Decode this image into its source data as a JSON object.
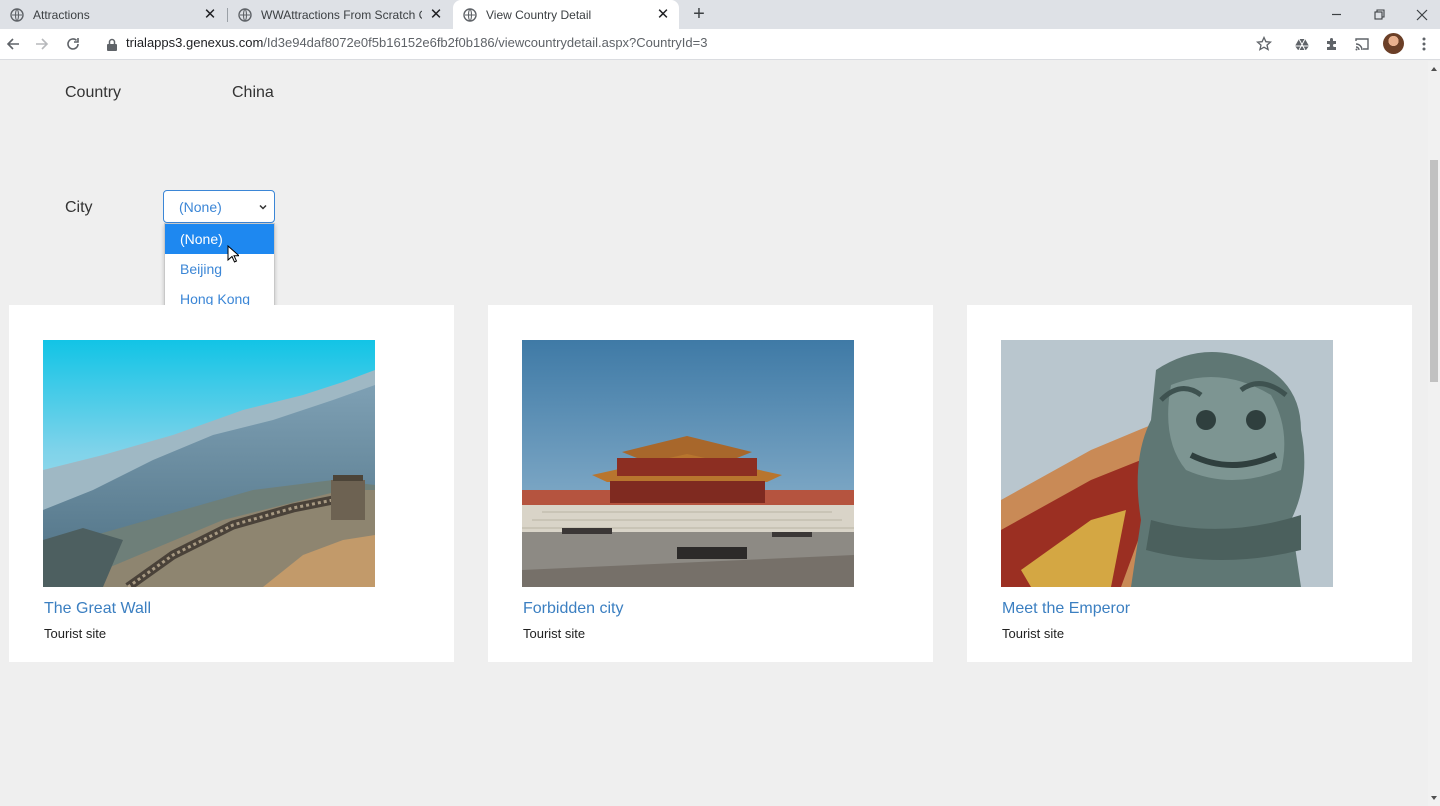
{
  "browser": {
    "tabs": [
      {
        "title": "Attractions",
        "active": false
      },
      {
        "title": "WWAttractions From Scratch Co",
        "active": false
      },
      {
        "title": "View Country Detail",
        "active": true
      }
    ],
    "url_host": "trialapps3.genexus.com",
    "url_path": "/Id3e94daf8072e0f5b16152e6fb2f0b186/viewcountrydetail.aspx?CountryId=3"
  },
  "form": {
    "country_label": "Country",
    "country_value": "China",
    "city_label": "City",
    "city_selected": "(None)",
    "city_options": [
      "(None)",
      "Beijing",
      "Hong Kong"
    ]
  },
  "attractions": [
    {
      "name": "The Great Wall",
      "category": "Tourist site",
      "image": "great-wall-photo"
    },
    {
      "name": "Forbidden city",
      "category": "Tourist site",
      "image": "forbidden-city-photo"
    },
    {
      "name": "Meet the Emperor",
      "category": "Tourist site",
      "image": "guardian-lion-photo"
    }
  ],
  "colors": {
    "link": "#3b7fc1",
    "select_accent": "#3b86d6",
    "option_highlight": "#1e88f0",
    "page_bg": "#efefef"
  }
}
